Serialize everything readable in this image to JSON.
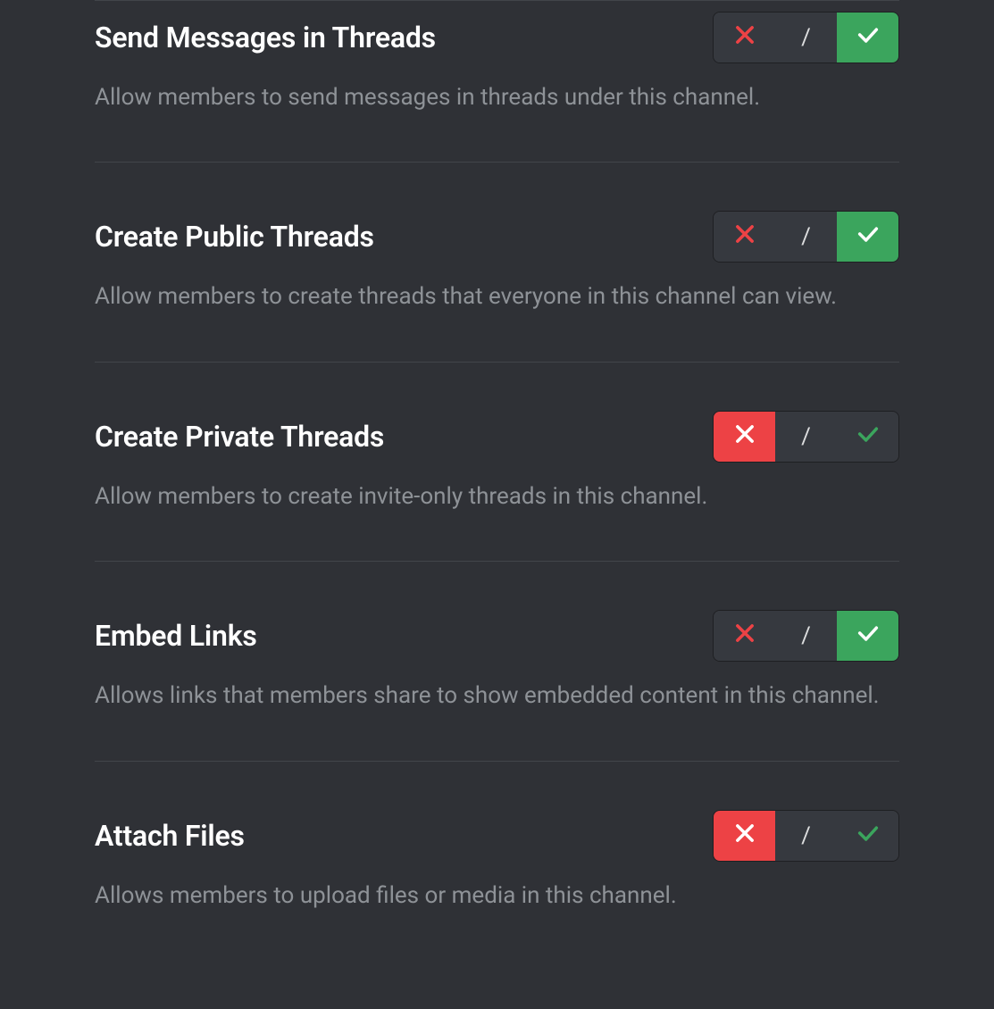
{
  "permissions": [
    {
      "title": "Send Messages in Threads",
      "description": "Allow members to send messages in threads under this channel.",
      "state": "allow"
    },
    {
      "title": "Create Public Threads",
      "description": "Allow members to create threads that everyone in this channel can view.",
      "state": "allow"
    },
    {
      "title": "Create Private Threads",
      "description": "Allow members to create invite-only threads in this channel.",
      "state": "deny"
    },
    {
      "title": "Embed Links",
      "description": "Allows links that members share to show embedded content in this channel.",
      "state": "allow"
    },
    {
      "title": "Attach Files",
      "description": "Allows members to upload files or media in this channel.",
      "state": "deny"
    }
  ],
  "neutral_label": "/"
}
